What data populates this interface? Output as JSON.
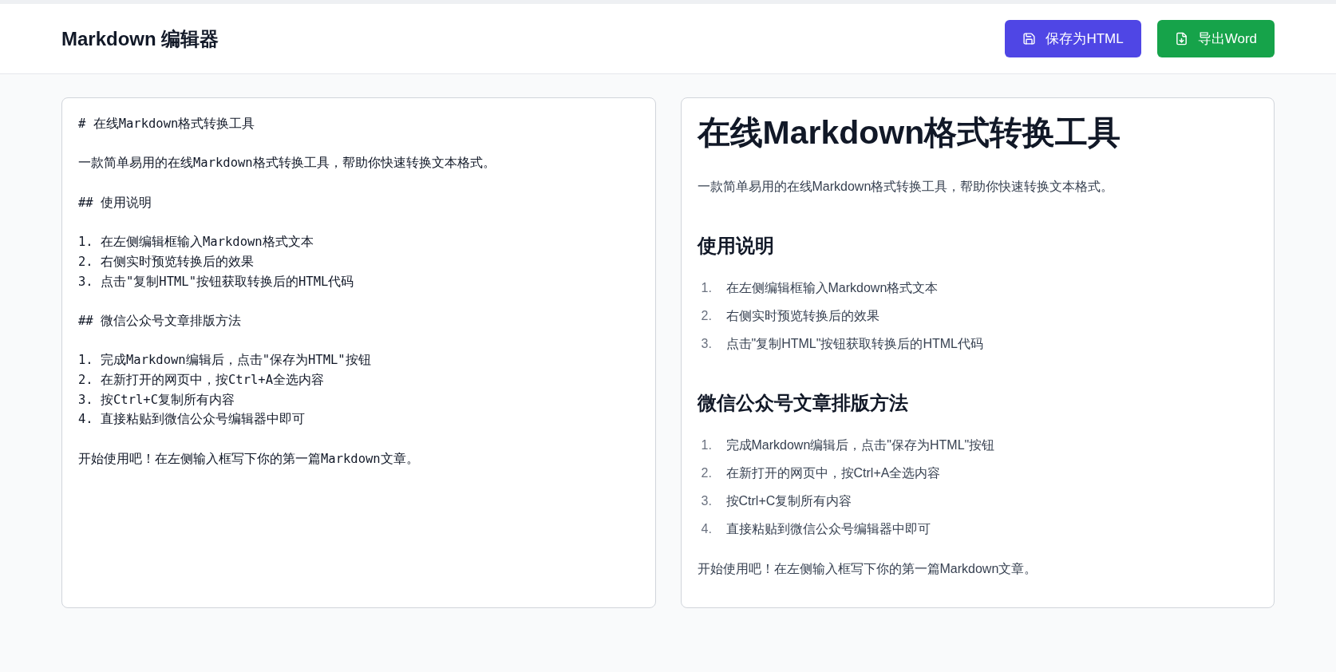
{
  "header": {
    "title": "Markdown 编辑器",
    "buttons": [
      {
        "kind": "save",
        "label": "保存为HTML"
      },
      {
        "kind": "export",
        "label": "导出Word"
      }
    ]
  },
  "editor": {
    "blocks": [
      [
        "# 在线Markdown格式转换工具"
      ],
      [
        "一款简单易用的在线Markdown格式转换工具，帮助你快速转换文本格式。"
      ],
      [
        "## 使用说明"
      ],
      [
        "1. 在左侧编辑框输入Markdown格式文本",
        "2. 右侧实时预览转换后的效果",
        "3. 点击\"复制HTML\"按钮获取转换后的HTML代码"
      ],
      [
        "## 微信公众号文章排版方法"
      ],
      [
        "1. 完成Markdown编辑后，点击\"保存为HTML\"按钮",
        "2. 在新打开的网页中，按Ctrl+A全选内容",
        "3. 按Ctrl+C复制所有内容",
        "4. 直接粘贴到微信公众号编辑器中即可"
      ],
      [
        "开始使用吧！在左侧输入框写下你的第一篇Markdown文章。"
      ]
    ]
  },
  "preview": [
    {
      "kind": "h1",
      "text": "在线Markdown格式转换工具"
    },
    {
      "kind": "p",
      "text": "一款简单易用的在线Markdown格式转换工具，帮助你快速转换文本格式。"
    },
    {
      "kind": "h2",
      "text": "使用说明"
    },
    {
      "kind": "ol",
      "items": [
        {
          "number": "1.",
          "text": "在左侧编辑框输入Markdown格式文本"
        },
        {
          "number": "2.",
          "text": "右侧实时预览转换后的效果"
        },
        {
          "number": "3.",
          "text": "点击\"复制HTML\"按钮获取转换后的HTML代码"
        }
      ]
    },
    {
      "kind": "h2",
      "text": "微信公众号文章排版方法"
    },
    {
      "kind": "ol",
      "items": [
        {
          "number": "1.",
          "text": "完成Markdown编辑后，点击\"保存为HTML\"按钮"
        },
        {
          "number": "2.",
          "text": "在新打开的网页中，按Ctrl+A全选内容"
        },
        {
          "number": "3.",
          "text": "按Ctrl+C复制所有内容"
        },
        {
          "number": "4.",
          "text": "直接粘贴到微信公众号编辑器中即可"
        }
      ]
    },
    {
      "kind": "p",
      "text": "开始使用吧！在左侧输入框写下你的第一篇Markdown文章。"
    }
  ]
}
